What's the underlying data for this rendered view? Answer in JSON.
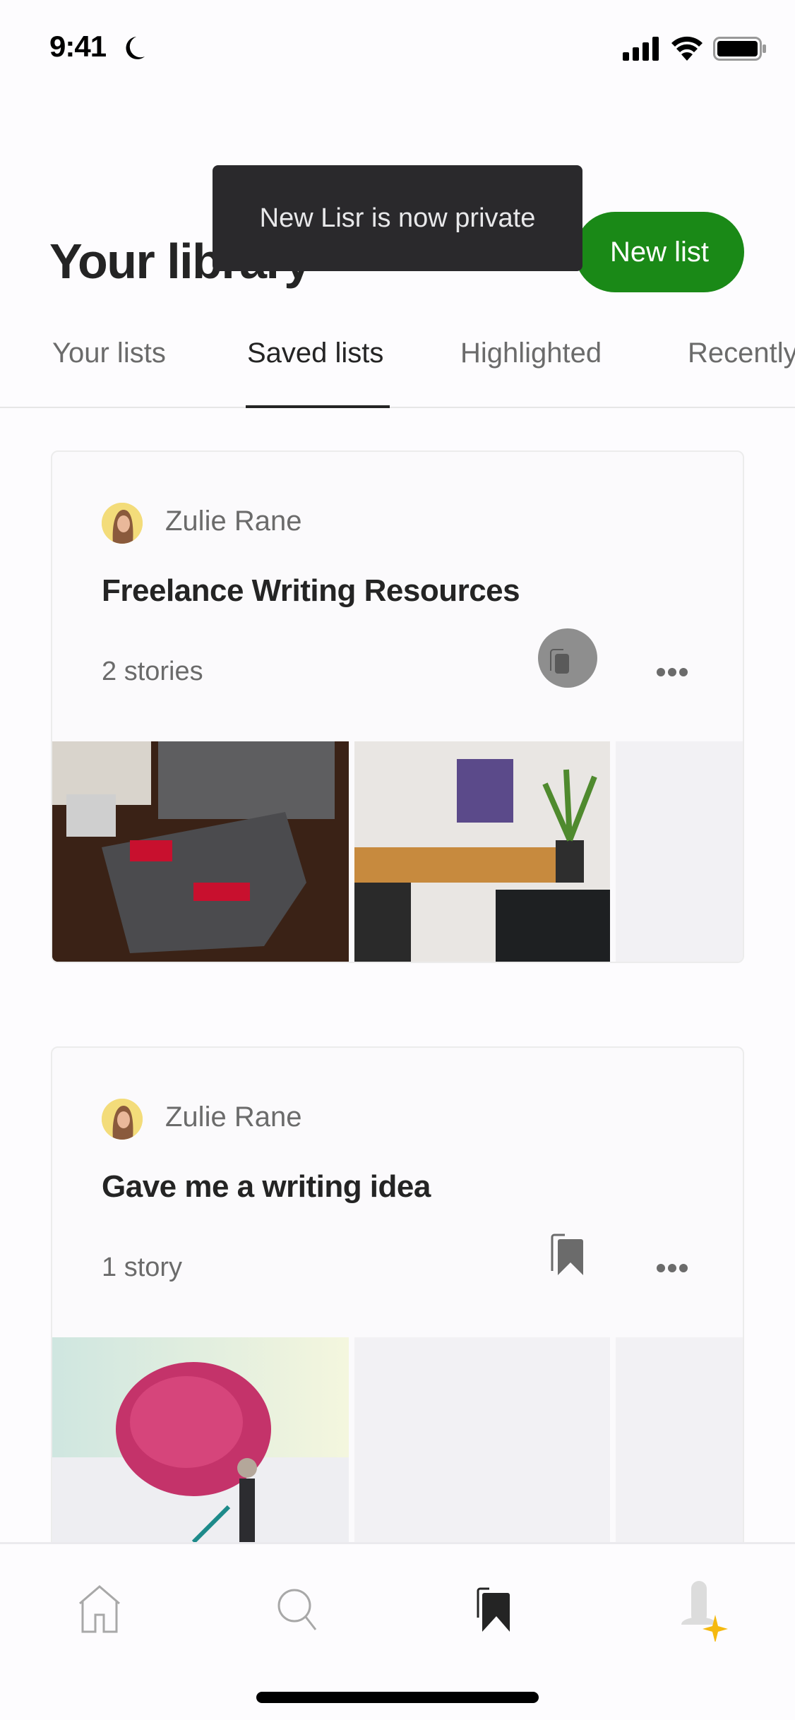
{
  "status_bar": {
    "time": "9:41",
    "focus_icon": "moon-icon",
    "icons": [
      "signal-icon",
      "wifi-icon",
      "battery-icon"
    ]
  },
  "header": {
    "title": "Your library",
    "new_list_label": "New list"
  },
  "toast": {
    "message": "New Lisr is now private"
  },
  "tabs": [
    {
      "label": "Your lists",
      "active": false
    },
    {
      "label": "Saved lists",
      "active": true
    },
    {
      "label": "Highlighted",
      "active": false
    },
    {
      "label": "Recently viewed",
      "active": false
    }
  ],
  "lists": [
    {
      "author": "Zulie Rane",
      "title": "Freelance Writing Resources",
      "count": "2 stories",
      "save_state": "pressed",
      "thumbnails": [
        "toolbox-photo",
        "desk-setup-photo",
        "empty"
      ]
    },
    {
      "author": "Zulie Rane",
      "title": "Gave me a writing idea",
      "count": "1 story",
      "save_state": "saved",
      "thumbnails": [
        "brain-illustration",
        "empty",
        "empty"
      ]
    }
  ],
  "bottom_nav": [
    {
      "name": "home",
      "icon": "home-icon",
      "active": false
    },
    {
      "name": "search",
      "icon": "search-icon",
      "active": false
    },
    {
      "name": "library",
      "icon": "bookmarks-icon",
      "active": true
    },
    {
      "name": "profile",
      "icon": "profile-icon",
      "active": false
    }
  ],
  "colors": {
    "accent": "#1a8917",
    "toast_bg": "#2a292c",
    "text_primary": "#242424",
    "text_secondary": "#6b6b6b",
    "star": "#f5b90f"
  }
}
